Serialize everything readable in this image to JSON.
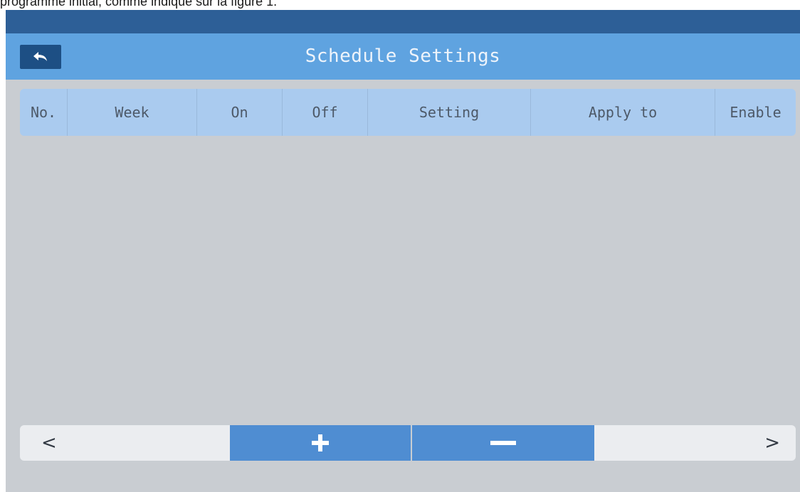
{
  "caption": "programme initial, comme indiqué sur la figure 1.",
  "header": {
    "title": "Schedule Settings",
    "back_icon": "back-arrow-icon"
  },
  "table": {
    "columns": [
      "No.",
      "Week",
      "On",
      "Off",
      "Setting",
      "Apply to",
      "Enable"
    ],
    "rows": []
  },
  "footer": {
    "prev_label": "<",
    "next_label": ">",
    "add_icon": "plus-icon",
    "remove_icon": "minus-icon"
  },
  "colors": {
    "top_strip": "#2d5f97",
    "title_bar": "#5fa3e0",
    "header_row": "#aacbef",
    "body": "#c9cdd2",
    "action_button": "#4f8dd2"
  }
}
